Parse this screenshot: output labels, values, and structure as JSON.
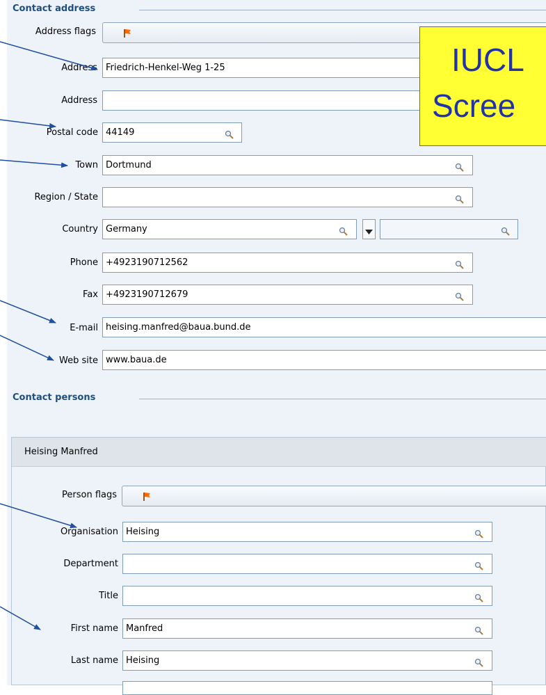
{
  "address_section": {
    "title": "Contact address",
    "address_flags_label": "Address flags",
    "address1_label": "Address",
    "address1_value": "Friedrich-Henkel-Weg 1-25",
    "address2_label": "Address",
    "address2_value": "",
    "postal_code_label": "Postal code",
    "postal_code_value": "44149",
    "town_label": "Town",
    "town_value": "Dortmund",
    "region_label": "Region / State",
    "region_value": "",
    "country_label": "Country",
    "country_value": "Germany",
    "country_secondary_value": "",
    "phone_label": "Phone",
    "phone_value": "+4923190712562",
    "fax_label": "Fax",
    "fax_value": "+4923190712679",
    "email_label": "E-mail",
    "email_value": "heising.manfred@baua.bund.de",
    "website_label": "Web site",
    "website_value": "www.baua.de"
  },
  "persons_section": {
    "title": "Contact persons",
    "person_name": "Heising Manfred",
    "person_flags_label": "Person flags",
    "organisation_label": "Organisation",
    "organisation_value": "Heising",
    "department_label": "Department",
    "department_value": "",
    "title_label": "Title",
    "title_value": "",
    "first_name_label": "First name",
    "first_name_value": "Manfred",
    "last_name_label": "Last name",
    "last_name_value": "Heising"
  },
  "callout": {
    "line1": "IUCL",
    "line2": "Scree"
  },
  "colors": {
    "section_title": "#1f4f7f",
    "panel_bg": "#eef3f9",
    "field_border": "#7f9db9",
    "callout_bg": "#ffff33",
    "callout_text": "#2233aa",
    "arrow": "#1f4fa0",
    "flag": "#ff6a00"
  },
  "icons": {
    "flag": "flag-icon",
    "search": "magnifier-icon",
    "dropdown": "triangle-down-icon"
  }
}
